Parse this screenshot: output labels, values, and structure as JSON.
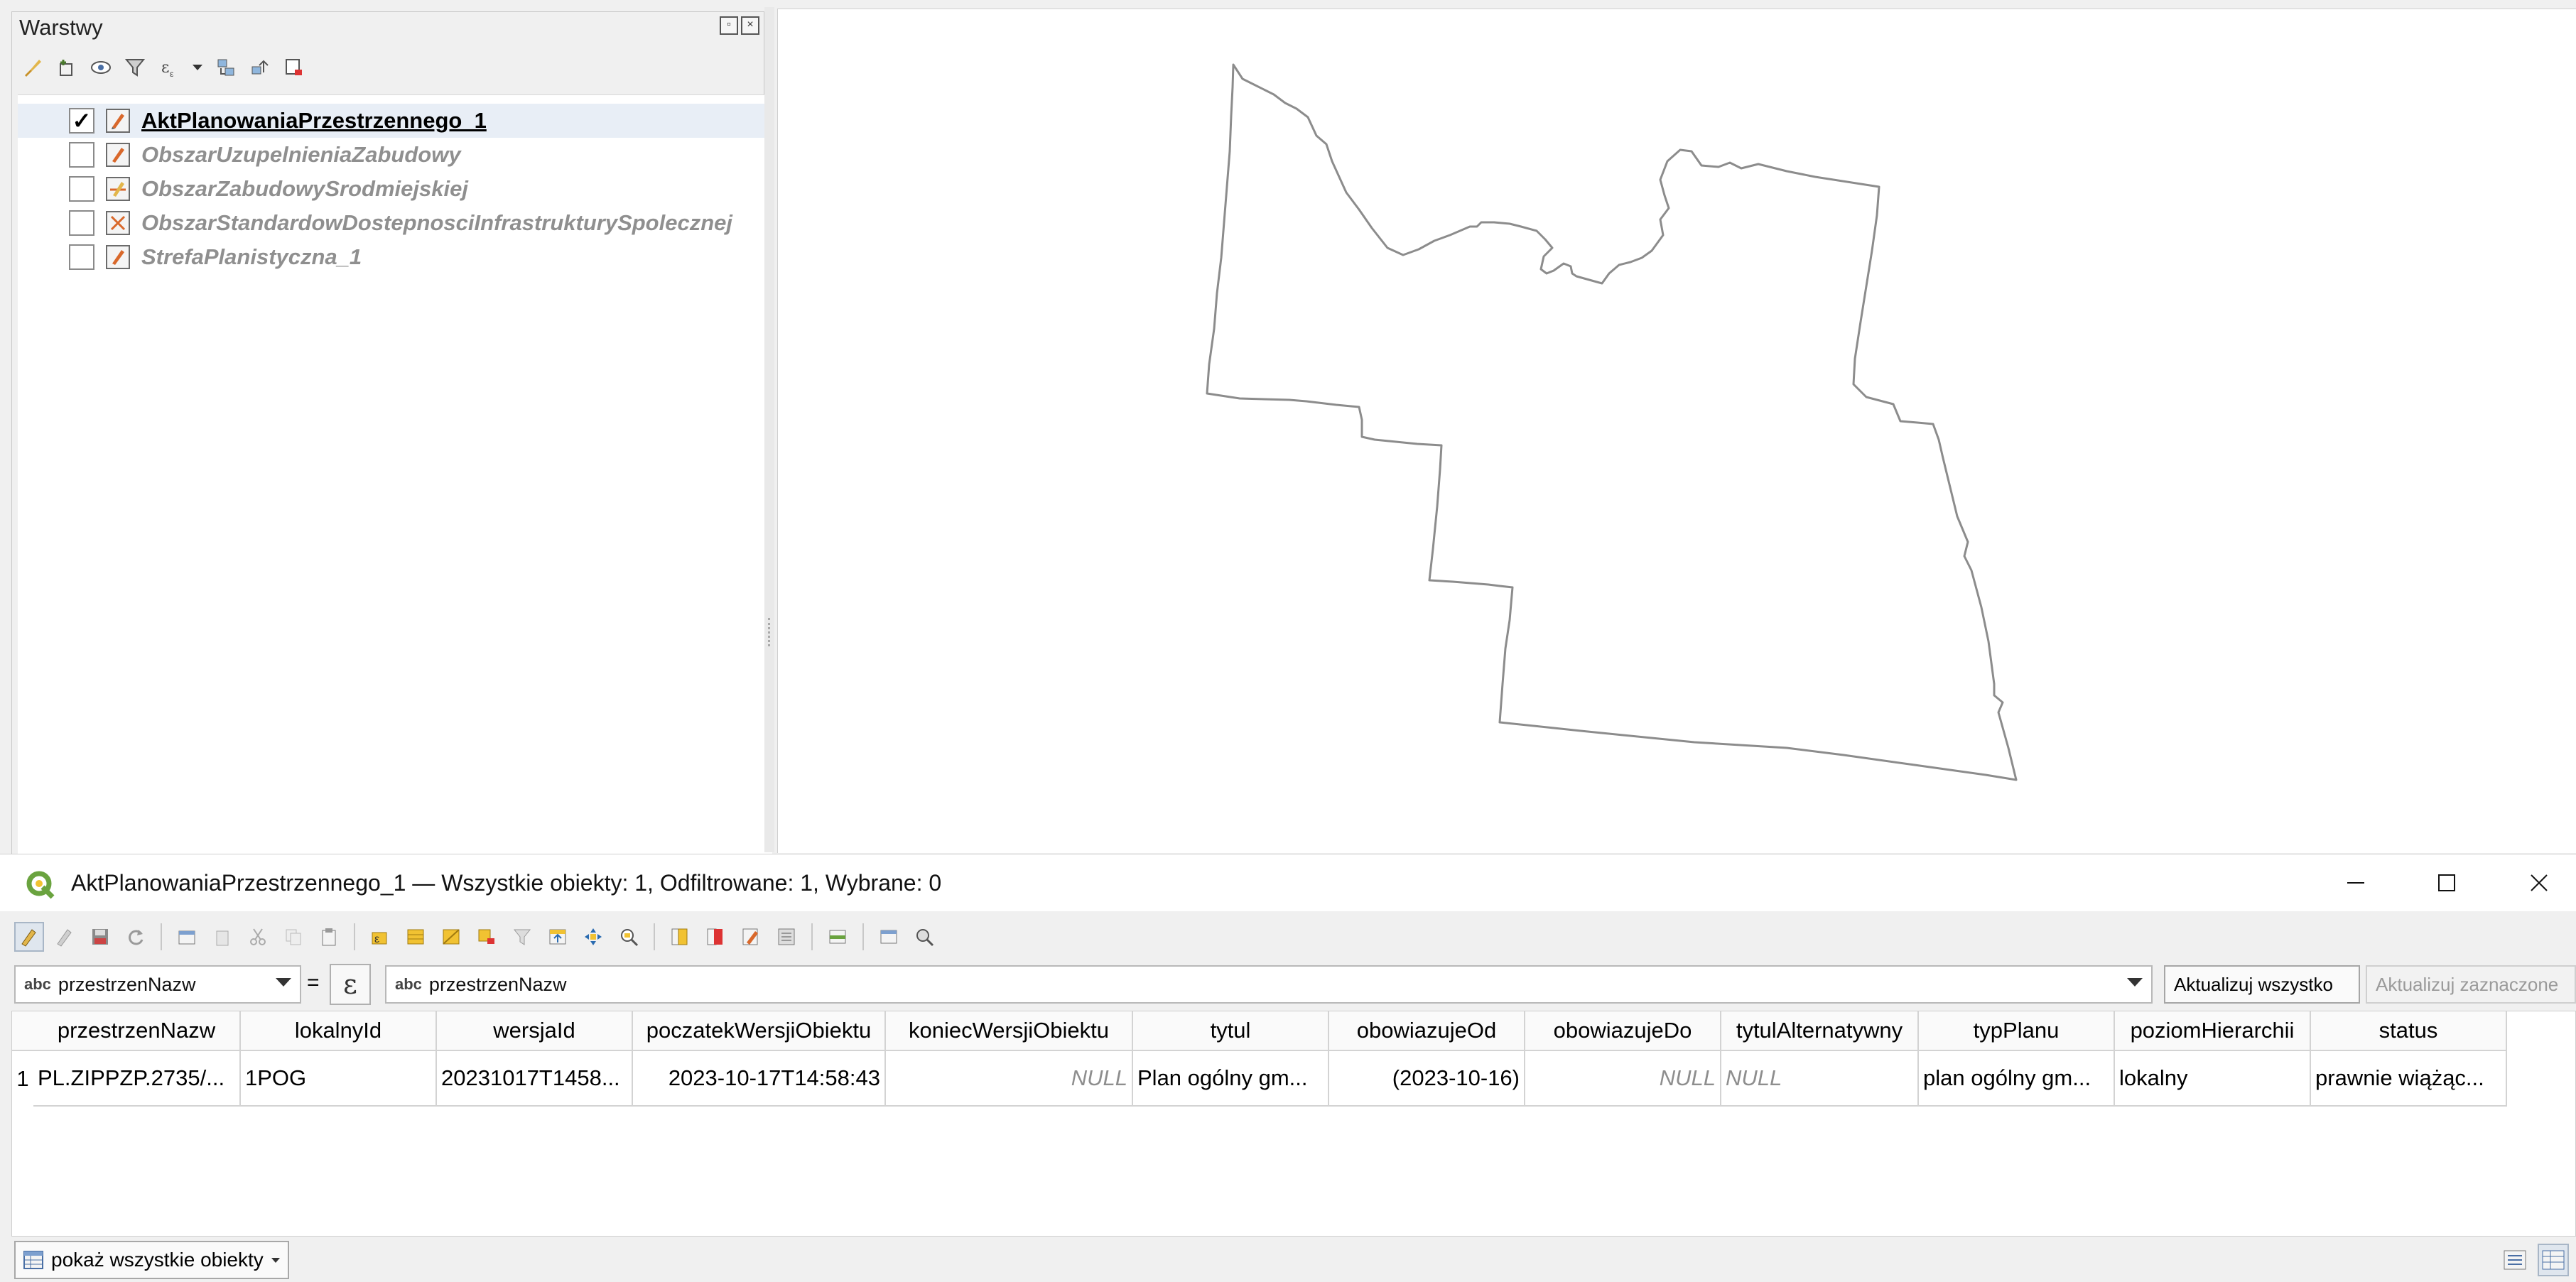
{
  "layers_panel": {
    "title": "Warstwy",
    "toolbar_icons": [
      "style-brush-icon",
      "add-group-icon",
      "visibility-eye-icon",
      "filter-legend-icon",
      "filter-expression-icon",
      "dropdown-arrow-icon",
      "expand-all-icon",
      "collapse-all-icon",
      "remove-layer-icon"
    ],
    "layers": [
      {
        "name": "AktPlanowaniaPrzestrzennego_1",
        "checked": true,
        "active": true
      },
      {
        "name": "ObszarUzupelnieniaZabudowy",
        "checked": false,
        "active": false
      },
      {
        "name": "ObszarZabudowySrodmiejskiej",
        "checked": false,
        "active": false
      },
      {
        "name": "ObszarStandardowDostepnosciInfrastrukturySpolecznej",
        "checked": false,
        "active": false
      },
      {
        "name": "StrefaPlanistyczna_1",
        "checked": false,
        "active": false
      }
    ],
    "check_mark": "✓"
  },
  "attribute_table": {
    "window_title": "AktPlanowaniaPrzestrzennego_1 — Wszystkie obiekty: 1, Odfiltrowane: 1, Wybrane: 0",
    "controls": {
      "minimize": "—",
      "maximize": "☐",
      "close": "✕"
    },
    "filter": {
      "field_type_badge": "abc",
      "field_name": "przestrzenNazw",
      "equals": "=",
      "expression_symbol": "ε",
      "value_type_badge": "abc",
      "value": "przestrzenNazw",
      "update_all": "Aktualizuj wszystko",
      "update_selected": "Aktualizuj zaznaczone"
    },
    "columns": [
      "przestrzenNazw",
      "lokalnyId",
      "wersjaId",
      "poczatekWersjiObiektu",
      "koniecWersjiObiektu",
      "tytul",
      "obowiazujeOd",
      "obowiazujeDo",
      "tytulAlternatywny",
      "typPlanu",
      "poziomHierarchii",
      "status"
    ],
    "rows": [
      {
        "num": "1",
        "cells": [
          "PL.ZIPPZP.2735/...",
          "1POG",
          "20231017T1458...",
          "2023-10-17T14:58:43",
          "NULL",
          "Plan ogólny gm...",
          "(2023-10-16)",
          "NULL",
          "NULL",
          "plan ogólny gm...",
          "lokalny",
          "prawnie wiążąc..."
        ]
      }
    ],
    "show_all_label": "pokaż wszystkie obiekty"
  },
  "colors": {
    "map_outline": "#8c8c8c",
    "qgis_green": "#6aa33f",
    "qgis_yellow": "#f1c232"
  }
}
